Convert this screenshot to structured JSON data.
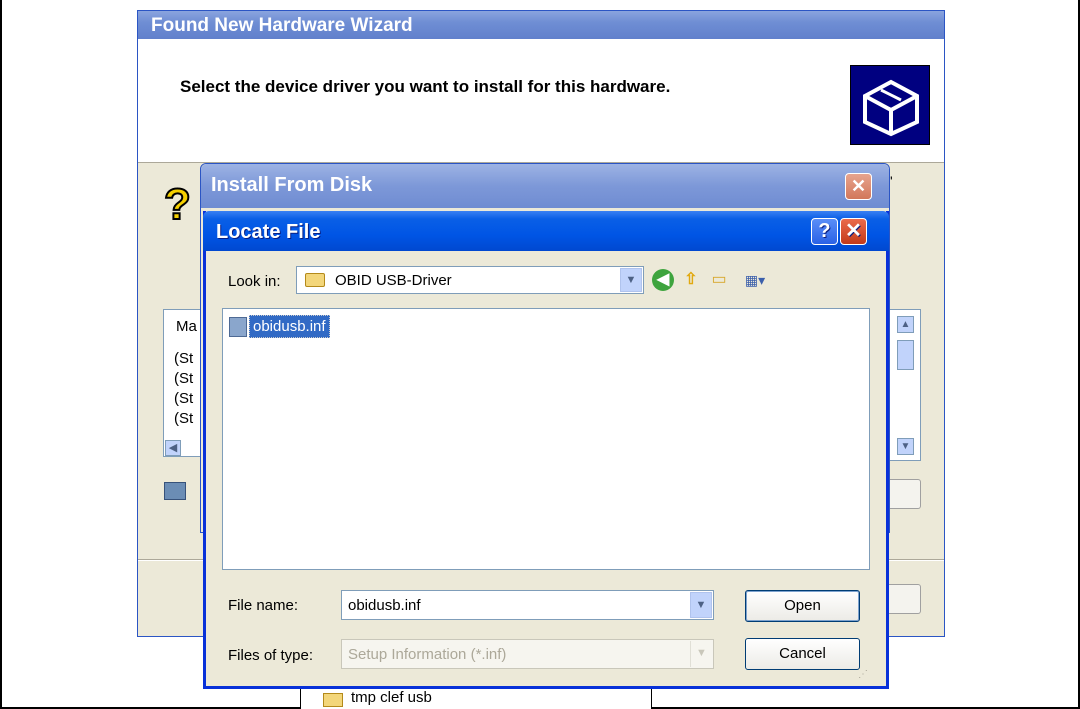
{
  "wizard": {
    "title": "Found New Hardware Wizard",
    "heading": "Select the device driver you want to install for this hardware.",
    "model_header": "Ma",
    "model_rows": [
      "(St",
      "(St",
      "(St",
      "(St"
    ],
    "edge_text": "'"
  },
  "install_disk": {
    "title": "Install From Disk",
    "close_glyph": "✕"
  },
  "locate_file": {
    "title": "Locate File",
    "help_glyph": "?",
    "close_glyph": "✕",
    "look_in_label": "Look in:",
    "look_in_value": "OBID USB-Driver",
    "files": [
      {
        "name": "obidusb.inf",
        "selected": true,
        "icon": "setup-information-file-icon"
      }
    ],
    "file_name_label": "File name:",
    "file_name_value": "obidusb.inf",
    "files_of_type_label": "Files of type:",
    "files_of_type_value": "Setup Information (*.inf)",
    "open_button": "Open",
    "cancel_button": "Cancel",
    "toolbar_icons": [
      "back-icon",
      "up-one-level-icon",
      "new-folder-icon",
      "views-menu-icon"
    ]
  },
  "background_folder": {
    "label": "tmp clef usb"
  },
  "colors": {
    "xp_titlebar_active": "#0055e5",
    "xp_titlebar_inactive": "#7d98d8",
    "selection": "#316ac5",
    "dialog_face": "#ece9d8"
  }
}
